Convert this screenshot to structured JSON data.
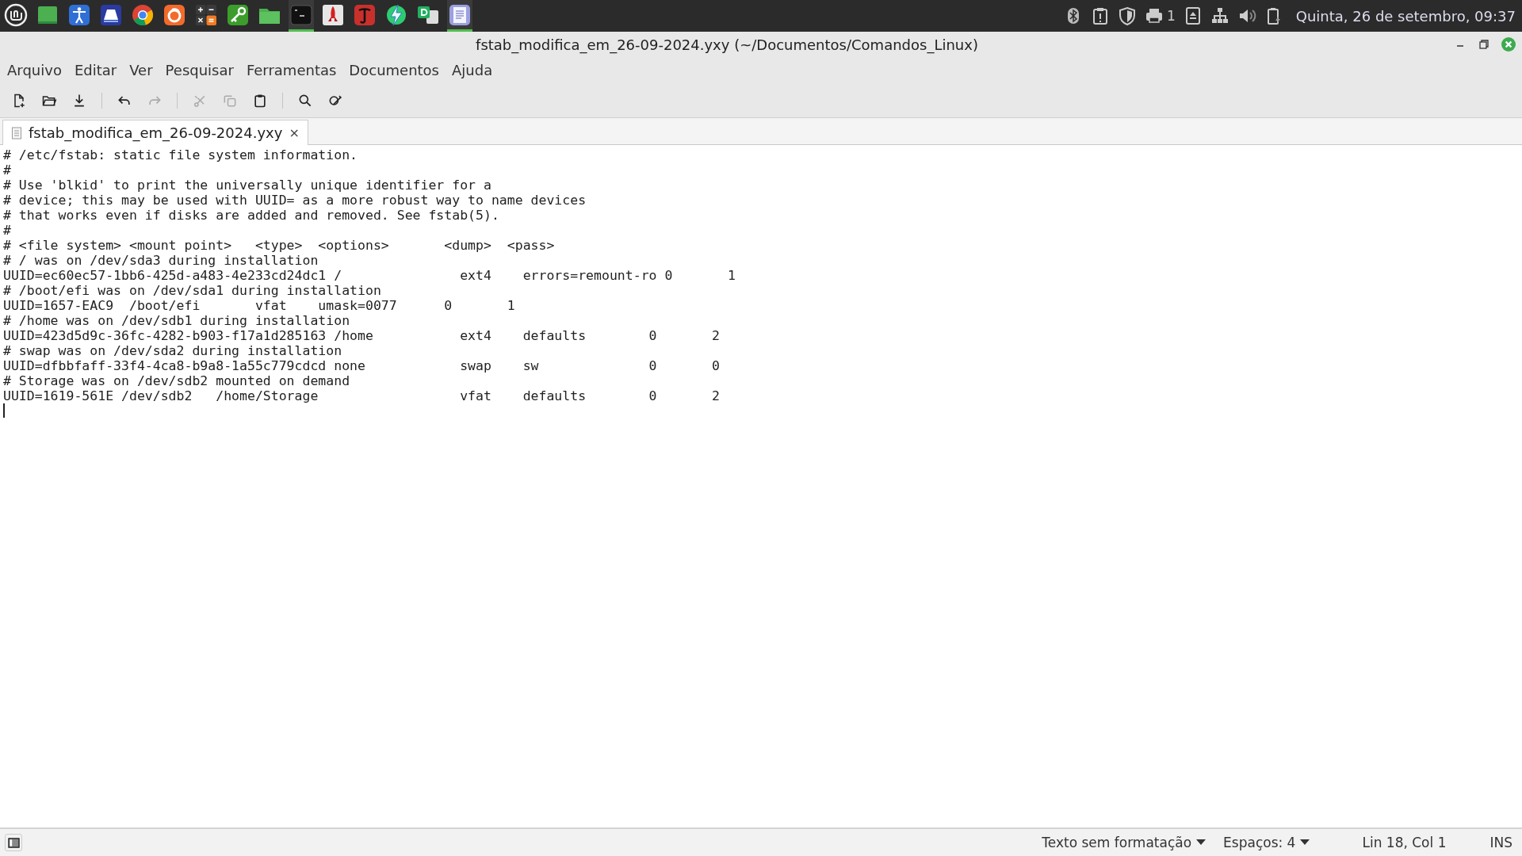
{
  "panel": {
    "launchers": [
      {
        "running": false
      },
      {
        "running": false
      },
      {
        "running": false
      },
      {
        "running": false
      },
      {
        "running": false
      },
      {
        "running": false
      },
      {
        "running": false
      },
      {
        "running": false
      },
      {
        "running": false
      },
      {
        "running": true
      },
      {
        "running": false
      },
      {
        "running": false
      },
      {
        "running": false
      },
      {
        "running": false
      },
      {
        "running": true
      }
    ],
    "printer_count": "1",
    "clock": "Quinta, 26 de setembro, 09:37"
  },
  "window": {
    "title": "fstab_modifica_em_26-09-2024.yxy (~/Documentos/Comandos_Linux)"
  },
  "menu": [
    "Arquivo",
    "Editar",
    "Ver",
    "Pesquisar",
    "Ferramentas",
    "Documentos",
    "Ajuda"
  ],
  "toolbar": [
    {
      "kind": "button",
      "disabled": false
    },
    {
      "kind": "button",
      "disabled": false
    },
    {
      "kind": "button",
      "disabled": false
    },
    {
      "kind": "separator"
    },
    {
      "kind": "button",
      "disabled": false
    },
    {
      "kind": "button",
      "disabled": true
    },
    {
      "kind": "separator"
    },
    {
      "kind": "button",
      "disabled": true
    },
    {
      "kind": "button",
      "disabled": true
    },
    {
      "kind": "button",
      "disabled": false
    },
    {
      "kind": "separator"
    },
    {
      "kind": "button",
      "disabled": false
    },
    {
      "kind": "button",
      "disabled": false
    }
  ],
  "tabs": [
    {
      "label": "fstab_modifica_em_26-09-2024.yxy",
      "close": "×",
      "selected": true
    }
  ],
  "editor": {
    "lines": [
      "# /etc/fstab: static file system information.",
      "#",
      "# Use 'blkid' to print the universally unique identifier for a",
      "# device; this may be used with UUID= as a more robust way to name devices",
      "# that works even if disks are added and removed. See fstab(5).",
      "#",
      "# <file system> <mount point>   <type>  <options>       <dump>  <pass>",
      "# / was on /dev/sda3 during installation",
      "UUID=ec60ec57-1bb6-425d-a483-4e233cd24dc1 /               ext4    errors=remount-ro 0       1",
      "# /boot/efi was on /dev/sda1 during installation",
      "UUID=1657-EAC9  /boot/efi       vfat    umask=0077      0       1",
      "# /home was on /dev/sdb1 during installation",
      "UUID=423d5d9c-36fc-4282-b903-f17a1d285163 /home           ext4    defaults        0       2",
      "# swap was on /dev/sda2 during installation",
      "UUID=dfbbfaff-33f4-4ca8-b9a8-1a55c779cdcd none            swap    sw              0       0",
      "# Storage was on /dev/sdb2 mounted on demand",
      "UUID=1619-561E /dev/sdb2   /home/Storage                  vfat    defaults        0       2"
    ]
  },
  "status_bar": {
    "syntax": "Texto sem formatação",
    "indent": "Espaços: 4",
    "position": "Lin 18, Col 1",
    "mode": "INS"
  }
}
